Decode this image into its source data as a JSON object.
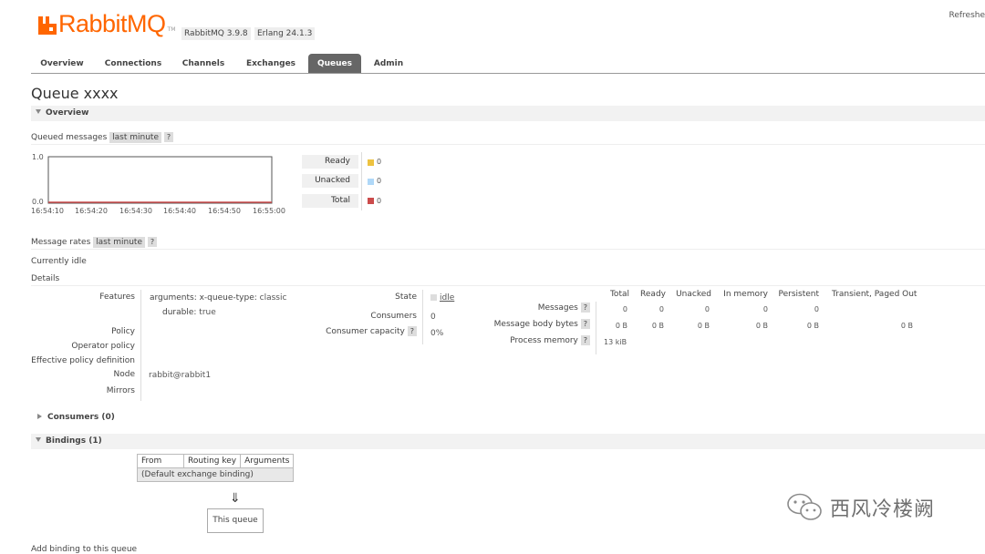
{
  "header": {
    "brand": "RabbitMQ",
    "tm": "TM",
    "rabbitmq_version": "RabbitMQ 3.9.8",
    "erlang_version": "Erlang 24.1.3",
    "refresh": "Refreshe"
  },
  "tabs": [
    {
      "label": "Overview"
    },
    {
      "label": "Connections"
    },
    {
      "label": "Channels"
    },
    {
      "label": "Exchanges"
    },
    {
      "label": "Queues",
      "active": true
    },
    {
      "label": "Admin"
    }
  ],
  "page_title": "Queue xxxx",
  "overview": {
    "section_label": "Overview",
    "queued_messages_label": "Queued messages",
    "queued_range": "last minute",
    "help": "?",
    "chart": {
      "y_max_label": "1.0",
      "y_min_label": "0.0",
      "x_ticks": [
        "16:54:10",
        "16:54:20",
        "16:54:30",
        "16:54:40",
        "16:54:50",
        "16:55:00"
      ]
    },
    "legend": [
      {
        "label": "Ready",
        "value": "0",
        "color": "#edc240"
      },
      {
        "label": "Unacked",
        "value": "0",
        "color": "#afd8f8"
      },
      {
        "label": "Total",
        "value": "0",
        "color": "#cb4b4b"
      }
    ],
    "message_rates_label": "Message rates",
    "rates_range": "last minute",
    "currently_idle": "Currently idle",
    "details_label": "Details"
  },
  "details": {
    "features_label": "Features",
    "arguments_key": "arguments:",
    "xqueue_key": "x-queue-type:",
    "xqueue_value": "classic",
    "durable_key": "durable:",
    "durable_value": "true",
    "policy_label": "Policy",
    "operator_policy_label": "Operator policy",
    "effective_policy_label": "Effective policy definition",
    "node_label": "Node",
    "node_value": "rabbit@rabbit1",
    "mirrors_label": "Mirrors",
    "state_label": "State",
    "state_value": "idle",
    "consumers_label": "Consumers",
    "consumers_value": "0",
    "consumer_capacity_label": "Consumer capacity",
    "consumer_capacity_value": "0%"
  },
  "stats": {
    "columns": [
      "Total",
      "Ready",
      "Unacked",
      "In memory",
      "Persistent",
      "Transient, Paged Out"
    ],
    "messages_label": "Messages",
    "messages": [
      "0",
      "0",
      "0",
      "0",
      "0"
    ],
    "body_bytes_label": "Message body bytes",
    "body_bytes": [
      "0 B",
      "0 B",
      "0 B",
      "0 B",
      "0 B",
      "0 B"
    ],
    "process_memory_label": "Process memory",
    "process_memory": "13 kiB"
  },
  "consumers_section": "Consumers (0)",
  "bindings_section": "Bindings (1)",
  "bindings_table": {
    "headers": [
      "From",
      "Routing key",
      "Arguments"
    ],
    "default_row": "(Default exchange binding)"
  },
  "arrow": "⇓",
  "this_queue": "This queue",
  "add_binding": "Add binding to this queue",
  "watermark": "西风冷楼阙"
}
